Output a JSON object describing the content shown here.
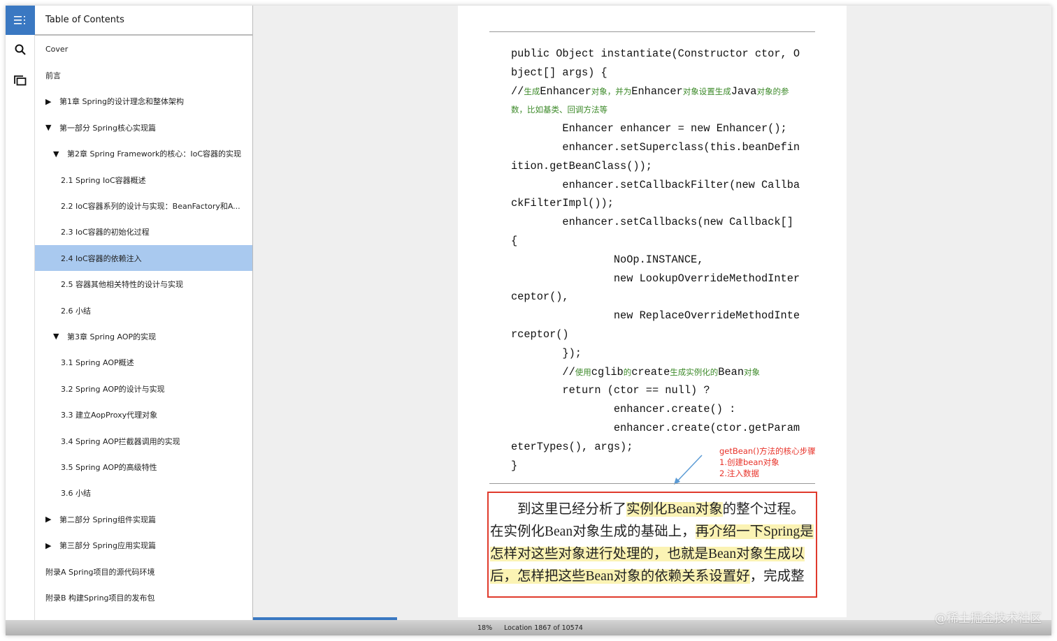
{
  "toc": {
    "title": "Table of Contents",
    "items": [
      {
        "label": "Cover",
        "arrow": "",
        "indent": 0
      },
      {
        "label": "前言",
        "arrow": "",
        "indent": 0
      },
      {
        "label": "第1章 Spring的设计理念和整体架构",
        "arrow": "▶",
        "indent": 0
      },
      {
        "label": "第一部分 Spring核心实现篇",
        "arrow": "▼",
        "indent": 0
      },
      {
        "label": "第2章 Spring Framework的核心：IoC容器的实现",
        "arrow": "▼",
        "indent": 1
      },
      {
        "label": "2.1 Spring IoC容器概述",
        "arrow": "",
        "indent": 2
      },
      {
        "label": "2.2 IoC容器系列的设计与实现：BeanFactory和A...",
        "arrow": "",
        "indent": 2
      },
      {
        "label": "2.3 IoC容器的初始化过程",
        "arrow": "",
        "indent": 2
      },
      {
        "label": "2.4 IoC容器的依赖注入",
        "arrow": "",
        "indent": 2,
        "selected": true
      },
      {
        "label": "2.5 容器其他相关特性的设计与实现",
        "arrow": "",
        "indent": 2
      },
      {
        "label": "2.6 小结",
        "arrow": "",
        "indent": 2
      },
      {
        "label": "第3章 Spring AOP的实现",
        "arrow": "▼",
        "indent": 1
      },
      {
        "label": "3.1 Spring AOP概述",
        "arrow": "",
        "indent": 2
      },
      {
        "label": "3.2 Spring AOP的设计与实现",
        "arrow": "",
        "indent": 2
      },
      {
        "label": "3.3 建立AopProxy代理对象",
        "arrow": "",
        "indent": 2
      },
      {
        "label": "3.4 Spring AOP拦截器调用的实现",
        "arrow": "",
        "indent": 2
      },
      {
        "label": "3.5 Spring AOP的高级特性",
        "arrow": "",
        "indent": 2
      },
      {
        "label": "3.6 小结",
        "arrow": "",
        "indent": 2
      },
      {
        "label": "第二部分 Spring组件实现篇",
        "arrow": "▶",
        "indent": 0
      },
      {
        "label": "第三部分 Spring应用实现篇",
        "arrow": "▶",
        "indent": 0
      },
      {
        "label": "附录A Spring项目的源代码环境",
        "arrow": "",
        "indent": 0
      },
      {
        "label": "附录B 构建Spring项目的发布包",
        "arrow": "",
        "indent": 0
      }
    ]
  },
  "code": [
    [
      {
        "t": "public Object instantiate(Constructor ctor, O",
        "c": "code"
      }
    ],
    [
      {
        "t": "bject[] args) {",
        "c": "code"
      }
    ],
    [
      {
        "t": "//",
        "c": "cmk"
      },
      {
        "t": "生成",
        "c": "cm"
      },
      {
        "t": "Enhancer",
        "c": "cmk"
      },
      {
        "t": "对象，并为",
        "c": "cm"
      },
      {
        "t": "Enhancer",
        "c": "cmk"
      },
      {
        "t": "对象设置生成",
        "c": "cm"
      },
      {
        "t": "Java",
        "c": "cmk"
      },
      {
        "t": "对象的参",
        "c": "cm"
      }
    ],
    [
      {
        "t": "数，比如基类、回调方法等",
        "c": "cm"
      }
    ],
    [
      {
        "t": "        Enhancer enhancer = new Enhancer();",
        "c": "code"
      }
    ],
    [
      {
        "t": "        enhancer.setSuperclass(this.beanDefin",
        "c": "code"
      }
    ],
    [
      {
        "t": "ition.getBeanClass());",
        "c": "code"
      }
    ],
    [
      {
        "t": "        enhancer.setCallbackFilter(new Callba",
        "c": "code"
      }
    ],
    [
      {
        "t": "ckFilterImpl());",
        "c": "code"
      }
    ],
    [
      {
        "t": "        enhancer.setCallbacks(new Callback[]",
        "c": "code"
      }
    ],
    [
      {
        "t": "{",
        "c": "code"
      }
    ],
    [
      {
        "t": "                NoOp.INSTANCE,",
        "c": "code"
      }
    ],
    [
      {
        "t": "                new LookupOverrideMethodInter",
        "c": "code"
      }
    ],
    [
      {
        "t": "ceptor(),",
        "c": "code"
      }
    ],
    [
      {
        "t": "                new ReplaceOverrideMethodInte",
        "c": "code"
      }
    ],
    [
      {
        "t": "rceptor()",
        "c": "code"
      }
    ],
    [
      {
        "t": "        });",
        "c": "code"
      }
    ],
    [
      {
        "t": "        //",
        "c": "cmk"
      },
      {
        "t": "使用",
        "c": "cm"
      },
      {
        "t": "cglib",
        "c": "cmk"
      },
      {
        "t": "的",
        "c": "cm"
      },
      {
        "t": "create",
        "c": "cmk"
      },
      {
        "t": "生成实例化的",
        "c": "cm"
      },
      {
        "t": "Bean",
        "c": "cmk"
      },
      {
        "t": "对象",
        "c": "cm"
      }
    ],
    [
      {
        "t": "        return (ctor == null) ?",
        "c": "code"
      }
    ],
    [
      {
        "t": "                enhancer.create() :",
        "c": "code"
      }
    ],
    [
      {
        "t": "                enhancer.create(ctor.getParam",
        "c": "code"
      }
    ],
    [
      {
        "t": "eterTypes(), args);",
        "c": "code"
      }
    ],
    [
      {
        "t": "}",
        "c": "code"
      }
    ]
  ],
  "annotation": {
    "line1": "getBean()方法的核心步骤",
    "line2": "1.创建bean对象",
    "line3": "2.注入数据",
    "color": "#e8332a"
  },
  "paragraph": [
    [
      {
        "t": "　　到这里已经分析了"
      },
      {
        "t": "实例化Bean对象",
        "hl": true
      },
      {
        "t": "的整个过程。"
      }
    ],
    [
      {
        "t": "在实例化Bean对象生成的基础上，"
      },
      {
        "t": "再介绍一下Spring是",
        "hl": true
      }
    ],
    [
      {
        "t": "怎样对这些对象进行处理的，也就是Bean对象生成以",
        "hl": true
      }
    ],
    [
      {
        "t": "后，怎样把这些Bean对象的依赖关系设置好",
        "hl": true
      },
      {
        "t": "，完成整"
      }
    ]
  ],
  "status": {
    "percent_label": "18%",
    "location": "Location 1867 of 10574",
    "progress": 0.18
  },
  "watermark": "@稀土掘金技术社区",
  "colors": {
    "accent": "#3a78c2",
    "selected": "#a9c9ef",
    "highlight": "#fbf3b4",
    "box": "#e03a2c"
  }
}
